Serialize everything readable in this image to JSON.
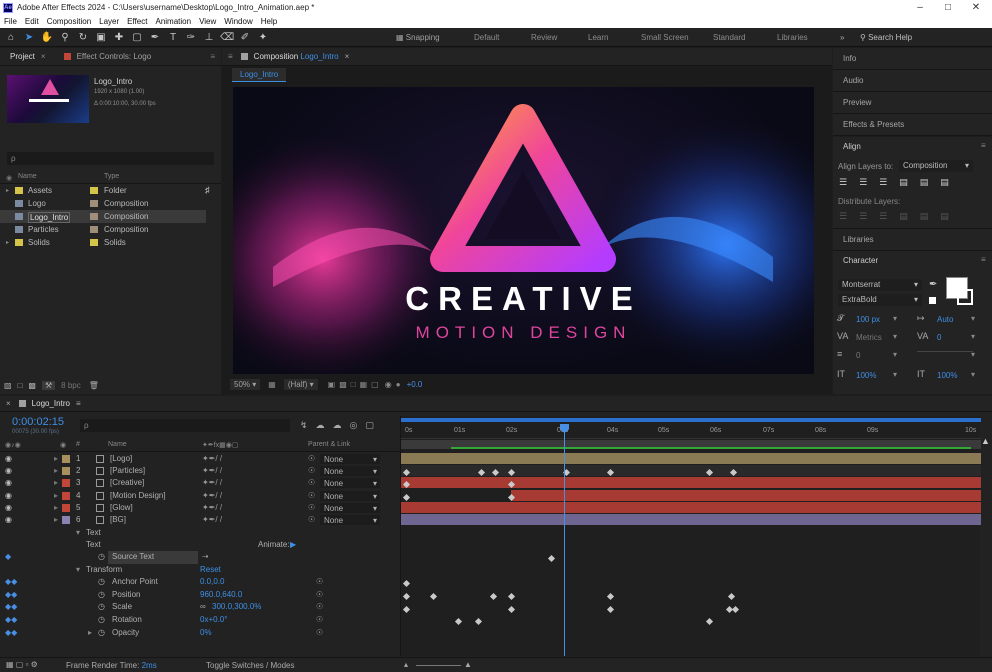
{
  "window": {
    "title": "Adobe After Effects 2024 - C:\\Users\\username\\Desktop\\Logo_Intro_Animation.aep *",
    "app_icon": "Ae"
  },
  "menu": [
    "File",
    "Edit",
    "Composition",
    "Layer",
    "Effect",
    "Animation",
    "View",
    "Window",
    "Help"
  ],
  "toolbar": {
    "snapping": "Snapping",
    "workspaces": [
      "Default",
      "Review",
      "Learn",
      "Small Screen",
      "Standard",
      "Libraries"
    ],
    "search_help": "Search Help"
  },
  "project": {
    "tab_project": "Project",
    "tab_effect_controls": "Effect Controls: Logo",
    "selected_name": "Logo_Intro",
    "selected_info1": "1920 x 1080 (1.00)",
    "selected_info2": "Δ 0:00:10:00, 30.00 fps",
    "search_placeholder": "ρ",
    "col_name": "Name",
    "col_type": "Type",
    "items": [
      {
        "name": "Assets",
        "type": "Folder",
        "color": "#d4c44a"
      },
      {
        "name": "Logo",
        "type": "Composition",
        "color": "#9e8e7a"
      },
      {
        "name": "Logo_Intro",
        "type": "Composition",
        "color": "#9e8e7a"
      },
      {
        "name": "Particles",
        "type": "Composition",
        "color": "#9e8e7a"
      },
      {
        "name": "Solids",
        "type": "Solids",
        "color": "#d4c44a"
      }
    ],
    "bpc": "8 bpc"
  },
  "composition": {
    "tab_label": "Composition",
    "tab_name": "Logo_Intro",
    "subtab": "Logo_Intro",
    "headline": "CREATIVE",
    "subline": "MOTION DESIGN",
    "zoom": "50%",
    "resolution": "(Half)",
    "exposure": "+0.0"
  },
  "right_panels": {
    "info": "Info",
    "audio": "Audio",
    "preview": "Preview",
    "effects": "Effects & Presets",
    "align": "Align",
    "align_layers_to": "Align Layers to:",
    "align_target": "Composition",
    "distribute": "Distribute Layers:",
    "libraries": "Libraries",
    "character": "Character",
    "font": "Montserrat",
    "style": "ExtraBold",
    "font_size": "100 px",
    "leading": "Auto",
    "kerning": "Metrics",
    "tracking": "0",
    "baseline": "0",
    "vscale": "100%",
    "hscale": "100%"
  },
  "timeline": {
    "comp_name": "Logo_Intro",
    "timecode": "0:00:02:15",
    "frames": "00075 (30.00 fps)",
    "col_name": "Name",
    "col_parent": "Parent & Link",
    "ruler": [
      "0s",
      "01s",
      "02s",
      "03s",
      "04s",
      "05s",
      "06s",
      "07s",
      "08s",
      "09s",
      "10s"
    ],
    "layers": [
      {
        "num": "1",
        "name": "[Logo]",
        "parent": "None",
        "color": "#a88f5e"
      },
      {
        "num": "2",
        "name": "[Particles]",
        "parent": "None",
        "color": "#a88f5e"
      },
      {
        "num": "3",
        "name": "[Creative]",
        "parent": "None",
        "color": "#c0463a"
      },
      {
        "num": "4",
        "name": "[Motion Design]",
        "parent": "None",
        "color": "#c0463a"
      },
      {
        "num": "5",
        "name": "[Glow]",
        "parent": "None",
        "color": "#c0463a"
      },
      {
        "num": "6",
        "name": "[BG]",
        "parent": "None",
        "color": "#8c82b4"
      }
    ],
    "props": {
      "text_group": "Text",
      "text_sub": "Text",
      "animate": "Animate:",
      "source_text": "Source Text",
      "transform": "Transform",
      "reset": "Reset",
      "anchor_label": "Anchor Point",
      "anchor_value": "0.0,0.0",
      "position_label": "Position",
      "position_value": "960.0,640.0",
      "scale_label": "Scale",
      "scale_value": "300.0,300.0%",
      "rotation_label": "Rotation",
      "rotation_value": "0x+0.0°",
      "opacity_label": "Opacity",
      "opacity_value": "0%"
    },
    "footer_render": "Frame Render Time:",
    "footer_render_value": "2ms",
    "footer_toggle": "Toggle Switches / Modes"
  }
}
